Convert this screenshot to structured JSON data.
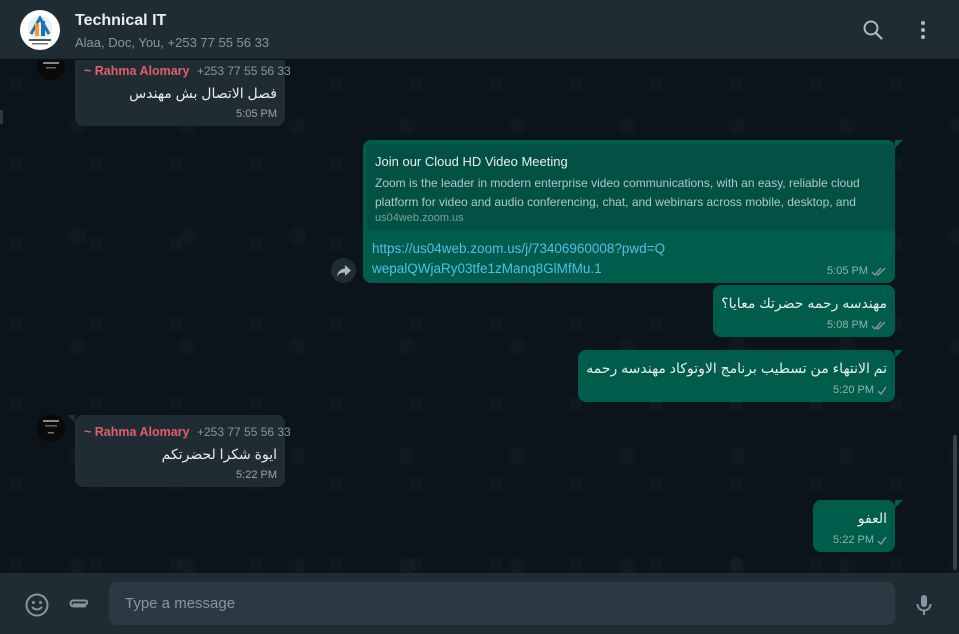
{
  "header": {
    "title": "Technical IT",
    "participants": "Alaa, Doc, You, +253 77 55 56 33",
    "icons": [
      "search-icon",
      "menu-icon"
    ]
  },
  "messages": [
    {
      "direction": "in",
      "sender": "~ Rahma Alomary",
      "phone": "+253 77 55 56 33",
      "text": "فصل الاتصال بش مهندس",
      "time": "5:05 PM"
    },
    {
      "direction": "out",
      "preview_title": "Join our Cloud HD Video Meeting",
      "preview_desc": "Zoom is the leader in modern enterprise video communications, with an easy, reliable cloud platform for video and audio conferencing, chat, and webinars across mobile, desktop, and",
      "preview_domain": "us04web.zoom.us",
      "link": "https://us04web.zoom.us/j/73406960008?pwd=QwepalQWjaRy03tfe1zManq8GlMfMu.1",
      "time": "5:05 PM",
      "status": "read"
    },
    {
      "direction": "out",
      "text": "مهندسه رحمه حضرتك معايا؟",
      "time": "5:08 PM",
      "status": "read"
    },
    {
      "direction": "out",
      "text": "تم الانتهاء من تسطيب برنامج الاوتوكاد مهندسه رحمه",
      "time": "5:20 PM",
      "status": "sent"
    },
    {
      "direction": "in",
      "sender": "~ Rahma Alomary",
      "phone": "+253 77 55 56 33",
      "text": "ايوة شكرا لحضرتكم",
      "time": "5:22 PM"
    },
    {
      "direction": "out",
      "text": "العفو",
      "time": "5:22 PM",
      "status": "sent"
    }
  ],
  "composer": {
    "placeholder": "Type a message",
    "icons": [
      "emoji-icon",
      "attach-icon",
      "microphone-icon"
    ]
  },
  "colors": {
    "background": "#0b141a",
    "panel": "#202c33",
    "incoming_bubble": "#202c33",
    "outgoing_bubble": "#005c4b",
    "sender_name": "#e35d6b",
    "link": "#53bdeb",
    "input": "#2a3942"
  }
}
